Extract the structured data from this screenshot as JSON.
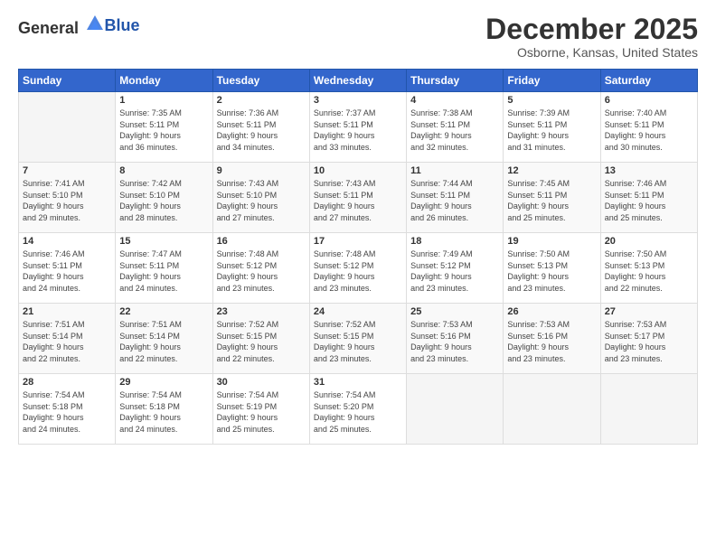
{
  "header": {
    "logo_general": "General",
    "logo_blue": "Blue",
    "month": "December 2025",
    "location": "Osborne, Kansas, United States"
  },
  "weekdays": [
    "Sunday",
    "Monday",
    "Tuesday",
    "Wednesday",
    "Thursday",
    "Friday",
    "Saturday"
  ],
  "weeks": [
    [
      {
        "day": "",
        "detail": ""
      },
      {
        "day": "1",
        "detail": "Sunrise: 7:35 AM\nSunset: 5:11 PM\nDaylight: 9 hours\nand 36 minutes."
      },
      {
        "day": "2",
        "detail": "Sunrise: 7:36 AM\nSunset: 5:11 PM\nDaylight: 9 hours\nand 34 minutes."
      },
      {
        "day": "3",
        "detail": "Sunrise: 7:37 AM\nSunset: 5:11 PM\nDaylight: 9 hours\nand 33 minutes."
      },
      {
        "day": "4",
        "detail": "Sunrise: 7:38 AM\nSunset: 5:11 PM\nDaylight: 9 hours\nand 32 minutes."
      },
      {
        "day": "5",
        "detail": "Sunrise: 7:39 AM\nSunset: 5:11 PM\nDaylight: 9 hours\nand 31 minutes."
      },
      {
        "day": "6",
        "detail": "Sunrise: 7:40 AM\nSunset: 5:11 PM\nDaylight: 9 hours\nand 30 minutes."
      }
    ],
    [
      {
        "day": "7",
        "detail": "Sunrise: 7:41 AM\nSunset: 5:10 PM\nDaylight: 9 hours\nand 29 minutes."
      },
      {
        "day": "8",
        "detail": "Sunrise: 7:42 AM\nSunset: 5:10 PM\nDaylight: 9 hours\nand 28 minutes."
      },
      {
        "day": "9",
        "detail": "Sunrise: 7:43 AM\nSunset: 5:10 PM\nDaylight: 9 hours\nand 27 minutes."
      },
      {
        "day": "10",
        "detail": "Sunrise: 7:43 AM\nSunset: 5:11 PM\nDaylight: 9 hours\nand 27 minutes."
      },
      {
        "day": "11",
        "detail": "Sunrise: 7:44 AM\nSunset: 5:11 PM\nDaylight: 9 hours\nand 26 minutes."
      },
      {
        "day": "12",
        "detail": "Sunrise: 7:45 AM\nSunset: 5:11 PM\nDaylight: 9 hours\nand 25 minutes."
      },
      {
        "day": "13",
        "detail": "Sunrise: 7:46 AM\nSunset: 5:11 PM\nDaylight: 9 hours\nand 25 minutes."
      }
    ],
    [
      {
        "day": "14",
        "detail": "Sunrise: 7:46 AM\nSunset: 5:11 PM\nDaylight: 9 hours\nand 24 minutes."
      },
      {
        "day": "15",
        "detail": "Sunrise: 7:47 AM\nSunset: 5:11 PM\nDaylight: 9 hours\nand 24 minutes."
      },
      {
        "day": "16",
        "detail": "Sunrise: 7:48 AM\nSunset: 5:12 PM\nDaylight: 9 hours\nand 23 minutes."
      },
      {
        "day": "17",
        "detail": "Sunrise: 7:48 AM\nSunset: 5:12 PM\nDaylight: 9 hours\nand 23 minutes."
      },
      {
        "day": "18",
        "detail": "Sunrise: 7:49 AM\nSunset: 5:12 PM\nDaylight: 9 hours\nand 23 minutes."
      },
      {
        "day": "19",
        "detail": "Sunrise: 7:50 AM\nSunset: 5:13 PM\nDaylight: 9 hours\nand 23 minutes."
      },
      {
        "day": "20",
        "detail": "Sunrise: 7:50 AM\nSunset: 5:13 PM\nDaylight: 9 hours\nand 22 minutes."
      }
    ],
    [
      {
        "day": "21",
        "detail": "Sunrise: 7:51 AM\nSunset: 5:14 PM\nDaylight: 9 hours\nand 22 minutes."
      },
      {
        "day": "22",
        "detail": "Sunrise: 7:51 AM\nSunset: 5:14 PM\nDaylight: 9 hours\nand 22 minutes."
      },
      {
        "day": "23",
        "detail": "Sunrise: 7:52 AM\nSunset: 5:15 PM\nDaylight: 9 hours\nand 22 minutes."
      },
      {
        "day": "24",
        "detail": "Sunrise: 7:52 AM\nSunset: 5:15 PM\nDaylight: 9 hours\nand 23 minutes."
      },
      {
        "day": "25",
        "detail": "Sunrise: 7:53 AM\nSunset: 5:16 PM\nDaylight: 9 hours\nand 23 minutes."
      },
      {
        "day": "26",
        "detail": "Sunrise: 7:53 AM\nSunset: 5:16 PM\nDaylight: 9 hours\nand 23 minutes."
      },
      {
        "day": "27",
        "detail": "Sunrise: 7:53 AM\nSunset: 5:17 PM\nDaylight: 9 hours\nand 23 minutes."
      }
    ],
    [
      {
        "day": "28",
        "detail": "Sunrise: 7:54 AM\nSunset: 5:18 PM\nDaylight: 9 hours\nand 24 minutes."
      },
      {
        "day": "29",
        "detail": "Sunrise: 7:54 AM\nSunset: 5:18 PM\nDaylight: 9 hours\nand 24 minutes."
      },
      {
        "day": "30",
        "detail": "Sunrise: 7:54 AM\nSunset: 5:19 PM\nDaylight: 9 hours\nand 25 minutes."
      },
      {
        "day": "31",
        "detail": "Sunrise: 7:54 AM\nSunset: 5:20 PM\nDaylight: 9 hours\nand 25 minutes."
      },
      {
        "day": "",
        "detail": ""
      },
      {
        "day": "",
        "detail": ""
      },
      {
        "day": "",
        "detail": ""
      }
    ]
  ]
}
